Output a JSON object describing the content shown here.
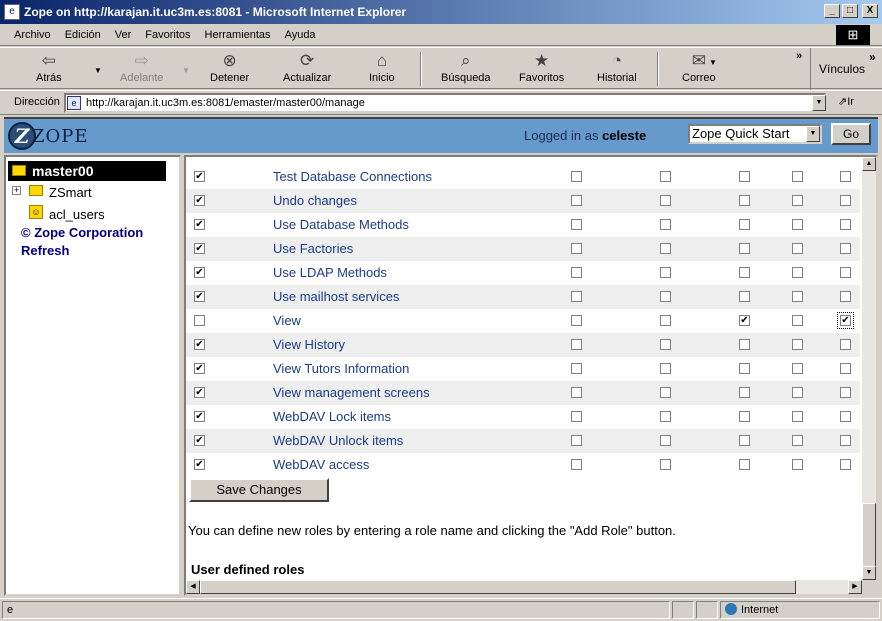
{
  "window": {
    "title": "Zope on http://karajan.it.uc3m.es:8081 - Microsoft Internet Explorer",
    "controls": [
      "_",
      "□",
      "X"
    ]
  },
  "menu": [
    "Archivo",
    "Edición",
    "Ver",
    "Favoritos",
    "Herramientas",
    "Ayuda"
  ],
  "toolbar": {
    "back": "Atrás",
    "forward": "Adelante",
    "stop": "Detener",
    "refresh": "Actualizar",
    "home": "Inicio",
    "search": "Búsqueda",
    "favorites": "Favoritos",
    "history": "Historial",
    "mail": "Correo",
    "links": "Vínculos",
    "chevron": "»"
  },
  "address": {
    "label": "Dirección",
    "url": "http://karajan.it.uc3m.es:8081/emaster/master00/manage",
    "go": "Ir"
  },
  "zope": {
    "logo": "ZOPE",
    "logged_prefix": "Logged in as",
    "user": "celeste",
    "quick_start": "Zope Quick Start",
    "go": "Go"
  },
  "tree": {
    "root": "master00",
    "items": [
      "ZSmart",
      "acl_users"
    ],
    "links": [
      "© Zope Corporation",
      "Refresh"
    ]
  },
  "permissions": [
    {
      "name": "Test Database Connections",
      "acquire": true,
      "roles": [
        false,
        false,
        false,
        false,
        false
      ]
    },
    {
      "name": "Undo changes",
      "acquire": true,
      "roles": [
        false,
        false,
        false,
        false,
        false
      ]
    },
    {
      "name": "Use Database Methods",
      "acquire": true,
      "roles": [
        false,
        false,
        false,
        false,
        false
      ]
    },
    {
      "name": "Use Factories",
      "acquire": true,
      "roles": [
        false,
        false,
        false,
        false,
        false
      ]
    },
    {
      "name": "Use LDAP Methods",
      "acquire": true,
      "roles": [
        false,
        false,
        false,
        false,
        false
      ]
    },
    {
      "name": "Use mailhost services",
      "acquire": true,
      "roles": [
        false,
        false,
        false,
        false,
        false
      ]
    },
    {
      "name": "View",
      "acquire": false,
      "roles": [
        false,
        false,
        true,
        false,
        true
      ]
    },
    {
      "name": "View History",
      "acquire": true,
      "roles": [
        false,
        false,
        false,
        false,
        false
      ]
    },
    {
      "name": "View Tutors Information",
      "acquire": true,
      "roles": [
        false,
        false,
        false,
        false,
        false
      ]
    },
    {
      "name": "View management screens",
      "acquire": true,
      "roles": [
        false,
        false,
        false,
        false,
        false
      ]
    },
    {
      "name": "WebDAV Lock items",
      "acquire": true,
      "roles": [
        false,
        false,
        false,
        false,
        false
      ]
    },
    {
      "name": "WebDAV Unlock items",
      "acquire": true,
      "roles": [
        false,
        false,
        false,
        false,
        false
      ]
    },
    {
      "name": "WebDAV access",
      "acquire": true,
      "roles": [
        false,
        false,
        false,
        false,
        false
      ]
    }
  ],
  "save_button": "Save Changes",
  "info_text": "You can define new roles by entering a role name and clicking the \"Add Role\" button.",
  "user_defined_roles": "User defined roles",
  "status": {
    "zone": "Internet"
  },
  "colors": {
    "zope_header": "#6699cc",
    "link": "#1a3c8a",
    "title_bar": "#0a246a"
  }
}
